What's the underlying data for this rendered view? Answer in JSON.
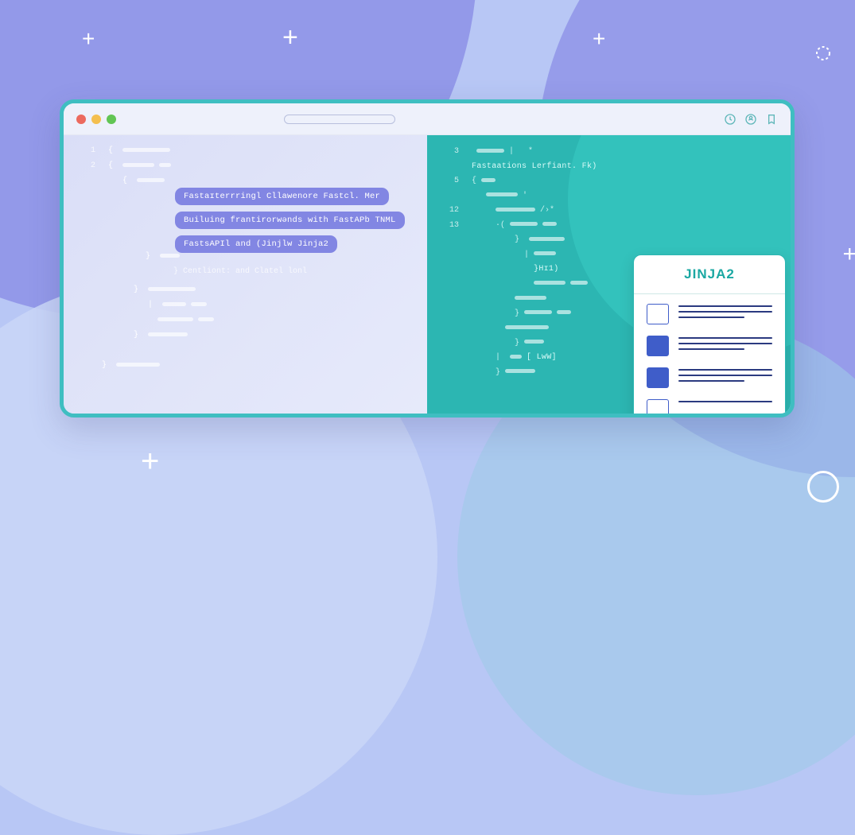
{
  "colors": {
    "bg": "#b8c7f5",
    "purple": "#8f94e8",
    "teal": "#2cb6b2",
    "accent_tag": "#8286e3",
    "card_title": "#1ba8a3"
  },
  "browser": {
    "traffic_lights": [
      "red",
      "yellow",
      "green"
    ],
    "toolbar_icons": [
      "clock-icon",
      "user-circle-icon",
      "bookmark-icon"
    ]
  },
  "left_pane": {
    "gutter": [
      "1",
      "2",
      ""
    ],
    "tags": {
      "t1": "Fastaɪterrringl Cllawenore Fastcl.  Mer",
      "t2": "Builuing frantirorwənds with FastAPb TNML",
      "t3": "FastsAPIl and (Jinjlw Jinja2"
    },
    "subtext": "}   Centliont: and Clatel lonl"
  },
  "right_pane": {
    "gutter": [
      "3",
      "",
      "5",
      "",
      "12",
      "13"
    ],
    "fn_label": "Fastaations Lerfiant. Fk)",
    "hi_label": "}Hɪ1)",
    "lww_label": "[ LwW]"
  },
  "card": {
    "title": "JINJA2"
  }
}
